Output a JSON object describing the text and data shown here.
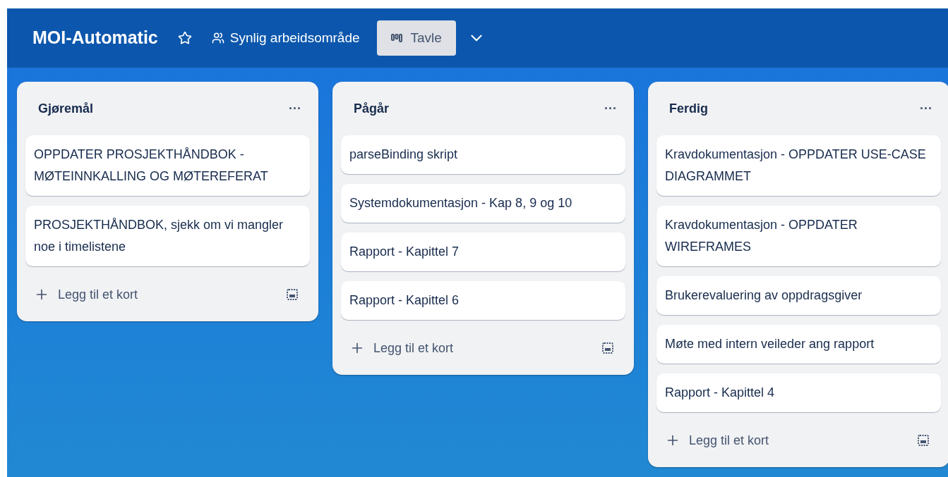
{
  "board": {
    "title": "MOI-Automatic",
    "visibility": "Synlig arbeidsområde",
    "views": [
      {
        "label": "Tavle",
        "selected": true
      }
    ]
  },
  "lists": [
    {
      "title": "Gjøremål",
      "menu": "···",
      "cards": [
        "OPPDATER PROSJEKTHÅNDBOK - MØTEINNKALLING OG MØTEREFERAT",
        "PROSJEKTHÅNDBOK, sjekk om vi mangler noe i timelistene"
      ],
      "add_label": "Legg til et kort"
    },
    {
      "title": "Pågår",
      "menu": "···",
      "cards": [
        "parseBinding skript",
        "Systemdokumentasjon - Kap 8, 9 og 10",
        "Rapport - Kapittel 7",
        "Rapport - Kapittel 6"
      ],
      "add_label": "Legg til et kort"
    },
    {
      "title": "Ferdig",
      "menu": "···",
      "cards": [
        "Kravdokumentasjon - OPPDATER USE-CASE DIAGRAMMET",
        "Kravdokumentasjon - OPPDATER WIREFRAMES",
        "Brukerevaluering av oppdragsgiver",
        "Møte med intern veileder ang rapport",
        "Rapport - Kapittel 4"
      ],
      "add_label": "Legg til et kort"
    }
  ]
}
